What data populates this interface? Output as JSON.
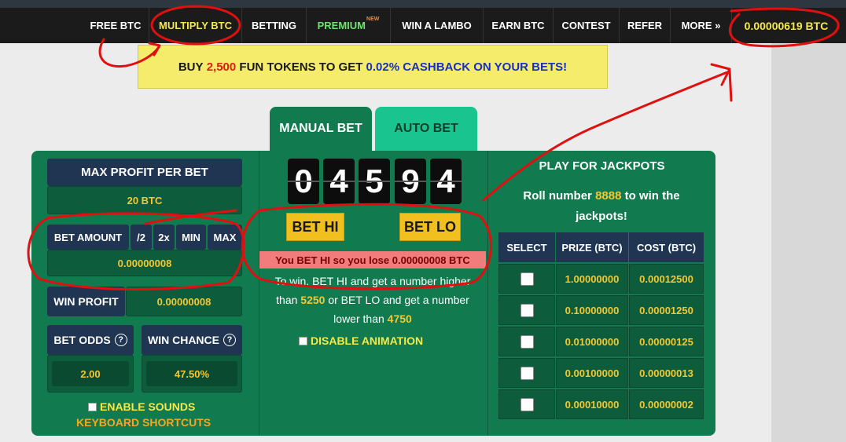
{
  "nav": {
    "items": [
      {
        "label": "FREE BTC"
      },
      {
        "label": "MULTIPLY BTC"
      },
      {
        "label": "BETTING"
      },
      {
        "label": "PREMIUM",
        "badge": "NEW"
      },
      {
        "label": "WIN A LAMBO"
      },
      {
        "label": "EARN BTC"
      },
      {
        "label": "CONTEST"
      },
      {
        "label": "REFER"
      },
      {
        "label": "MORE »"
      }
    ],
    "balance": "0.00000619 BTC"
  },
  "banner": {
    "part1": "BUY ",
    "amount": "2,500",
    "part2": " FUN TOKENS TO GET ",
    "cashback": "0.02% CASHBACK ON YOUR BETS!"
  },
  "tabs": {
    "manual": "MANUAL BET",
    "auto": "AUTO BET"
  },
  "left": {
    "max_profit_label": "MAX PROFIT PER BET",
    "max_profit_value": "20 BTC",
    "bet_amount_label": "BET AMOUNT",
    "half_label": "/2",
    "double_label": "2x",
    "min_label": "MIN",
    "max_label": "MAX",
    "bet_amount_value": "0.00000008",
    "win_profit_label": "WIN PROFIT",
    "win_profit_value": "0.00000008",
    "bet_odds_label": "BET ODDS",
    "bet_odds_value": "2.00",
    "win_chance_label": "WIN CHANCE",
    "win_chance_value": "47.50%",
    "help_glyph": "?",
    "enable_sounds": "ENABLE SOUNDS",
    "keyboard_shortcuts": "KEYBOARD SHORTCUTS"
  },
  "center": {
    "digits": [
      "0",
      "4",
      "5",
      "9",
      "4"
    ],
    "bet_hi": "BET HI",
    "bet_lo": "BET LO",
    "result": "You BET HI so you lose 0.00000008 BTC",
    "info_line1": "To win, BET HI and get a number higher",
    "info_than": "than ",
    "hi_threshold": "5250",
    "info_mid": " or BET LO and get a number",
    "info_lower": "lower than ",
    "lo_threshold": "4750",
    "disable_animation": "DISABLE ANIMATION"
  },
  "jackpot": {
    "title": "PLAY FOR JACKPOTS",
    "sub_pre": "Roll number ",
    "sub_number": "8888",
    "sub_post": " to win the jackpots!",
    "headers": [
      "SELECT",
      "PRIZE (BTC)",
      "COST (BTC)"
    ],
    "rows": [
      {
        "prize": "1.00000000",
        "cost": "0.00012500"
      },
      {
        "prize": "0.10000000",
        "cost": "0.00001250"
      },
      {
        "prize": "0.01000000",
        "cost": "0.00000125"
      },
      {
        "prize": "0.00100000",
        "cost": "0.00000013"
      },
      {
        "prize": "0.00010000",
        "cost": "0.00000002"
      }
    ]
  }
}
